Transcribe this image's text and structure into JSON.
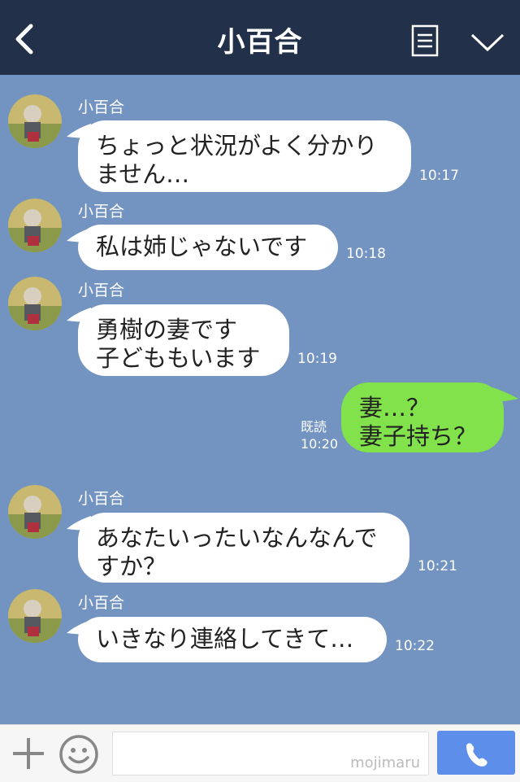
{
  "header": {
    "title": "小百合",
    "back_icon": "chevron-left-icon",
    "menu_icon": "notes-list-icon",
    "expand_icon": "chevron-down-icon"
  },
  "messages": [
    {
      "sender": "小百合",
      "lines": [
        "ちょっと状況がよく分かり",
        "ません…"
      ],
      "time": "10:17"
    },
    {
      "sender": "小百合",
      "lines": [
        "私は姉じゃないです"
      ],
      "time": "10:18"
    },
    {
      "sender": "小百合",
      "lines": [
        "勇樹の妻です",
        "子どももいます"
      ],
      "time": "10:19"
    },
    {
      "sender": "me",
      "lines": [
        "妻…？",
        "妻子持ち？"
      ],
      "time": "10:20",
      "read_label": "既読"
    },
    {
      "sender": "小百合",
      "lines": [
        "あなたいったいなんなんで",
        "すか？"
      ],
      "time": "10:21"
    },
    {
      "sender": "小百合",
      "lines": [
        "いきなり連絡してきて…"
      ],
      "time": "10:22"
    }
  ],
  "footer": {
    "plus_icon": "plus-icon",
    "emoji_icon": "smiley-icon",
    "watermark": "mojimaru",
    "call_icon": "phone-icon"
  },
  "colors": {
    "header_bg": "#22304a",
    "chat_bg": "#7393c1",
    "bubble_incoming": "#ffffff",
    "bubble_outgoing": "#82e24b",
    "call_button": "#5d8eea"
  }
}
